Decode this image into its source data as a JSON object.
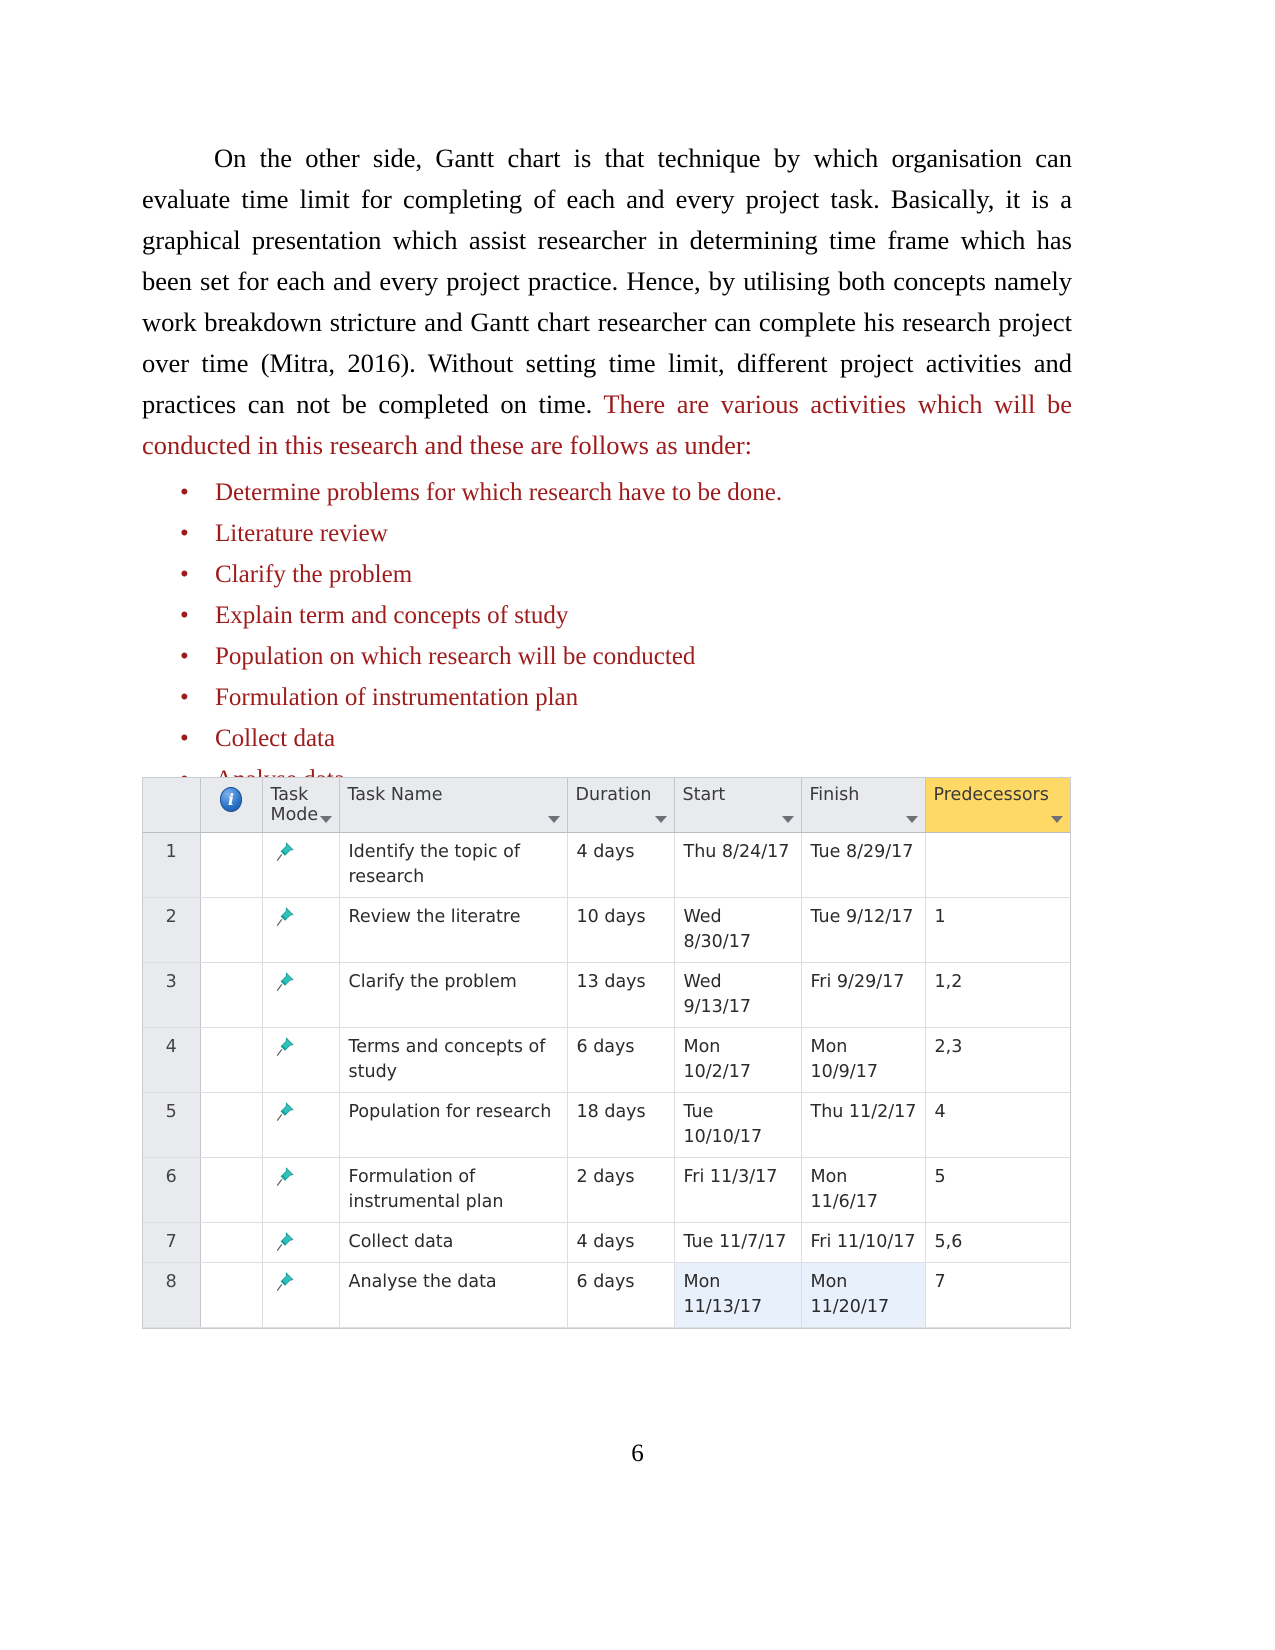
{
  "document": {
    "page_number": "6",
    "paragraph": {
      "black_part": "On the other side, Gantt chart is that technique by which organisation can evaluate time limit for completing of each and every project task. Basically, it is a graphical presentation which assist researcher in determining time frame which has been set for each and every project practice. Hence, by utilising both concepts namely work breakdown stricture and Gantt chart researcher can complete his research project over time (Mitra, 2016). Without setting time limit, different project activities and practices can not be completed on time.  ",
      "red_part": "There are various activities which will be conducted in this research and these are follows as under:"
    },
    "bullet_marker": "•",
    "bullets": [
      "Determine problems for which research have to be done.",
      "Literature review",
      "Clarify the problem",
      "Explain term and concepts of study",
      "Population on which research will be conducted",
      "Formulation of instrumentation plan",
      "Collect data",
      "Analyse data"
    ]
  },
  "gantt_table": {
    "columns": {
      "id": "",
      "info": "i",
      "task_mode": "Task Mode",
      "task_name": "Task Name",
      "duration": "Duration",
      "start": "Start",
      "finish": "Finish",
      "predecessors": "Predecessors"
    },
    "highlight_color": "#ffd966",
    "selection_color": "#e8f0fb",
    "pin_color": "#29b8b0",
    "rows": [
      {
        "id": "1",
        "task_name": "Identify the topic of research",
        "duration": "4 days",
        "start": "Thu 8/24/17",
        "finish": "Tue 8/29/17",
        "predecessors": ""
      },
      {
        "id": "2",
        "task_name": "Review the literatre",
        "duration": "10 days",
        "start": "Wed 8/30/17",
        "finish": "Tue 9/12/17",
        "predecessors": "1"
      },
      {
        "id": "3",
        "task_name": "Clarify the problem",
        "duration": "13 days",
        "start": "Wed 9/13/17",
        "finish": "Fri 9/29/17",
        "predecessors": "1,2"
      },
      {
        "id": "4",
        "task_name": "Terms and concepts of study",
        "duration": "6 days",
        "start": "Mon 10/2/17",
        "finish": "Mon 10/9/17",
        "predecessors": "2,3"
      },
      {
        "id": "5",
        "task_name": "Population for research",
        "duration": "18 days",
        "start": "Tue 10/10/17",
        "finish": "Thu 11/2/17",
        "predecessors": "4"
      },
      {
        "id": "6",
        "task_name": "Formulation of instrumental plan",
        "duration": "2 days",
        "start": "Fri 11/3/17",
        "finish": "Mon 11/6/17",
        "predecessors": "5"
      },
      {
        "id": "7",
        "task_name": "Collect data",
        "duration": "4 days",
        "start": "Tue 11/7/17",
        "finish": "Fri 11/10/17",
        "predecessors": "5,6"
      },
      {
        "id": "8",
        "task_name": "Analyse the data",
        "duration": "6 days",
        "start": "Mon 11/13/17",
        "finish": "Mon 11/20/17",
        "predecessors": "7",
        "selected": true
      }
    ]
  }
}
